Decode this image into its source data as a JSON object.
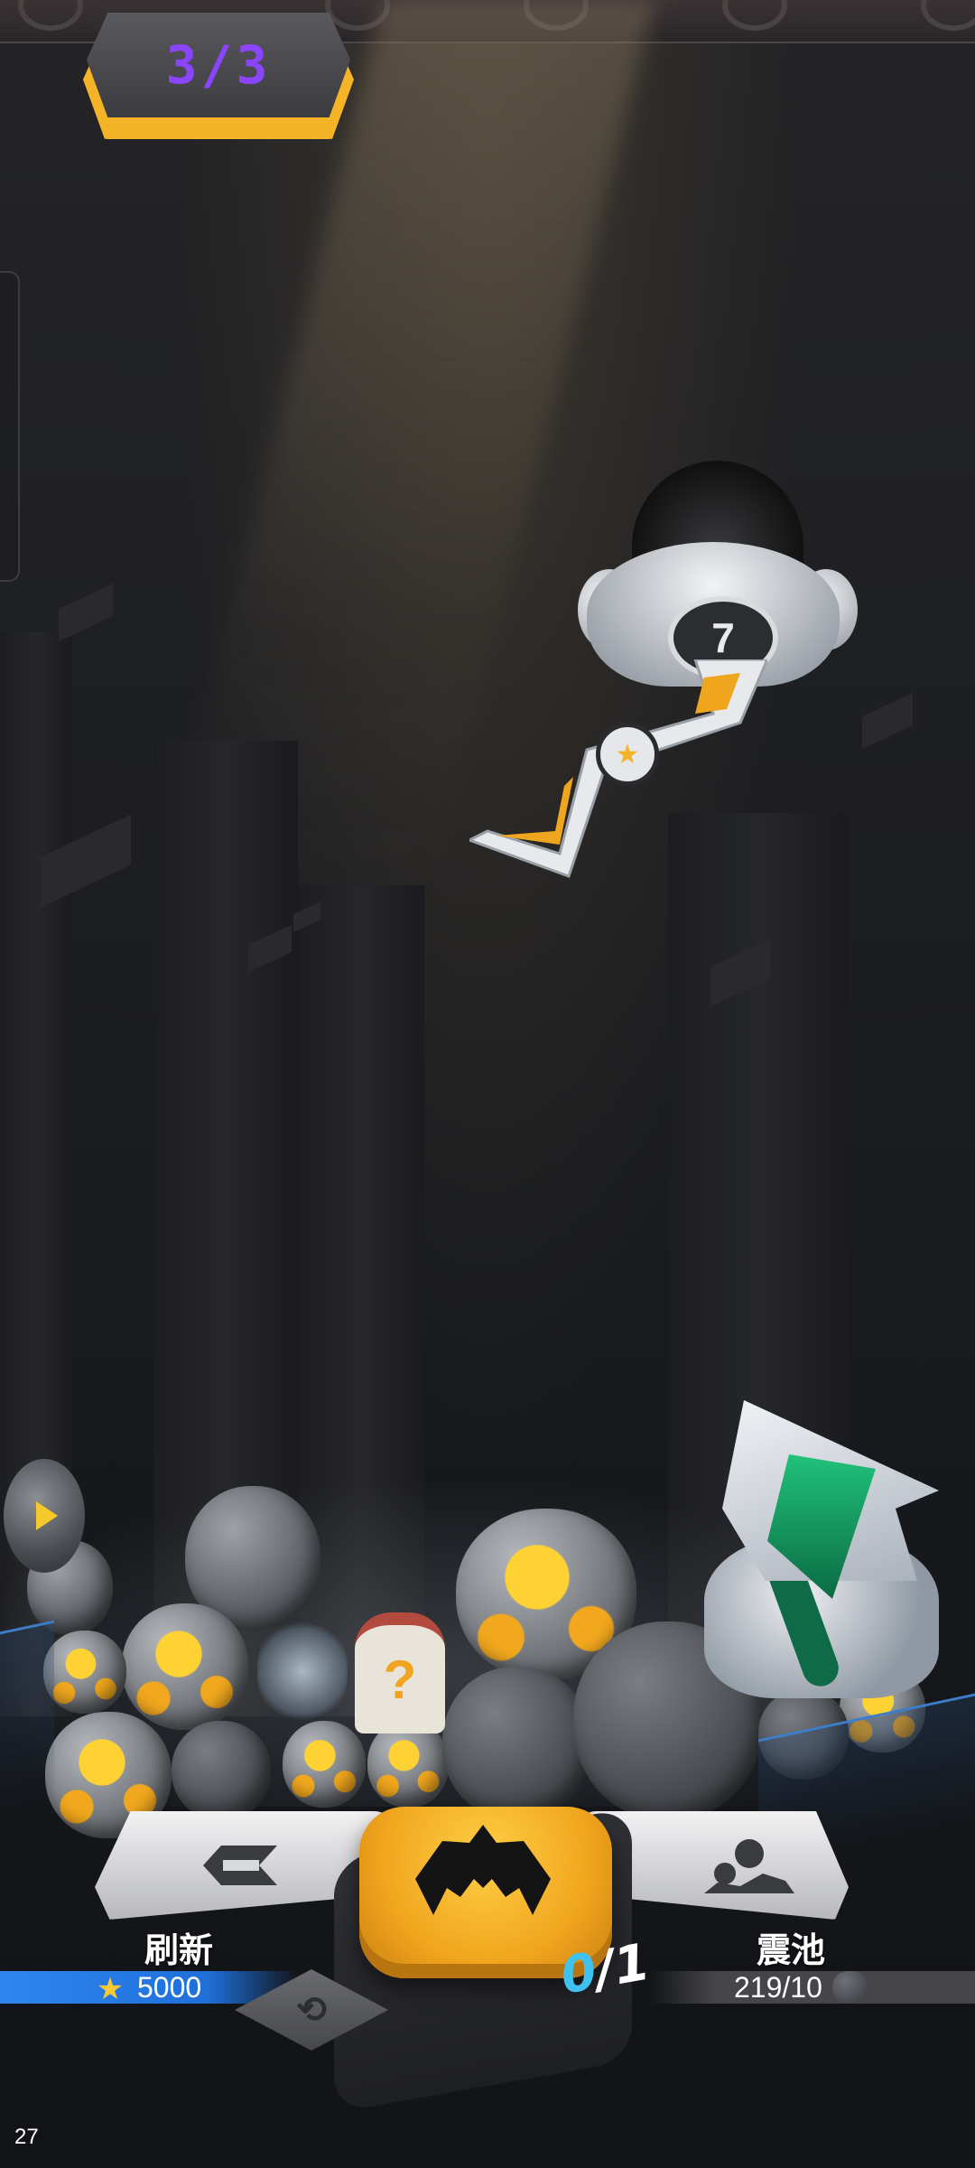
{
  "hud": {
    "round_counter": "3/3",
    "fps": "27"
  },
  "claw_machine": {
    "number": "7",
    "icon": "star-icon"
  },
  "prizes": {
    "mystery_card_glyph": "?",
    "robot_icon": "robot-icon"
  },
  "controls": {
    "refresh": {
      "label": "刷新",
      "cost": "5000",
      "currency_icon": "star-coin-icon"
    },
    "pool": {
      "label": "震池",
      "count": "219/10",
      "ore_icon": "ore-rock-icon"
    },
    "grab": {
      "current": "0",
      "total": "/1"
    },
    "play_icon": "play-icon",
    "swap_icon": "swap-icon"
  },
  "colors": {
    "accent_gold": "#f5b428",
    "counter_purple": "#8b45ff",
    "cost_blue": "#2f86ef",
    "grab_count_blue": "#3fc2f0",
    "robot_green": "#20c27a"
  }
}
